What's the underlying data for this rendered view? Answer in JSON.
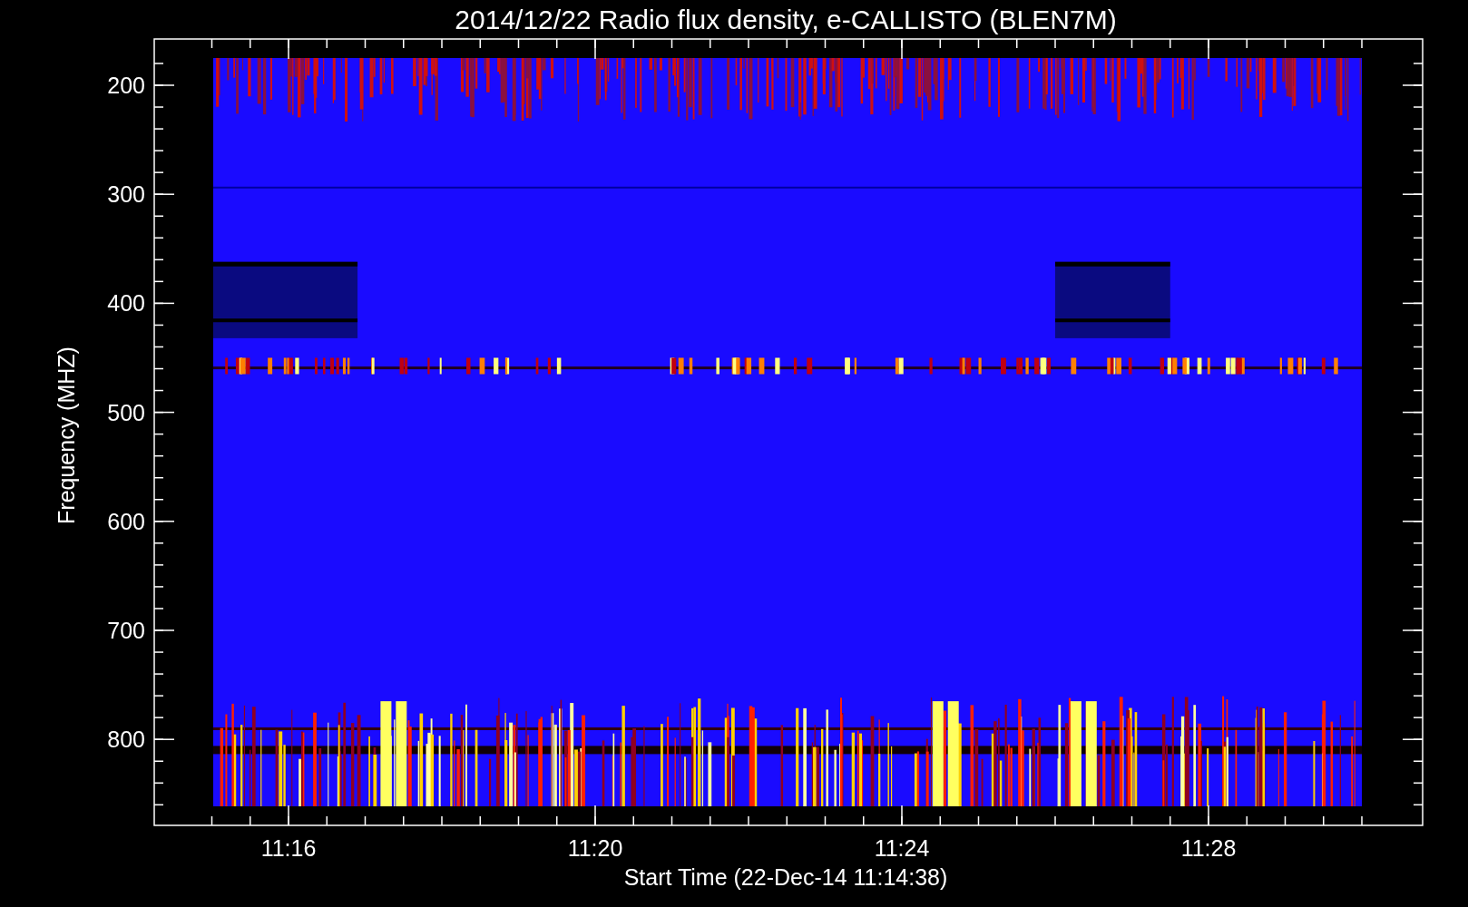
{
  "title": "2014/12/22  Radio flux density, e-CALLISTO (BLEN7M)",
  "y_axis": {
    "label": "Frequency (MHZ)",
    "ticks": [
      "200",
      "300",
      "400",
      "500",
      "600",
      "700",
      "800"
    ]
  },
  "x_axis": {
    "label": "Start Time (22-Dec-14 11:14:38)",
    "ticks": [
      "11:16",
      "11:20",
      "11:24",
      "11:28"
    ]
  }
}
